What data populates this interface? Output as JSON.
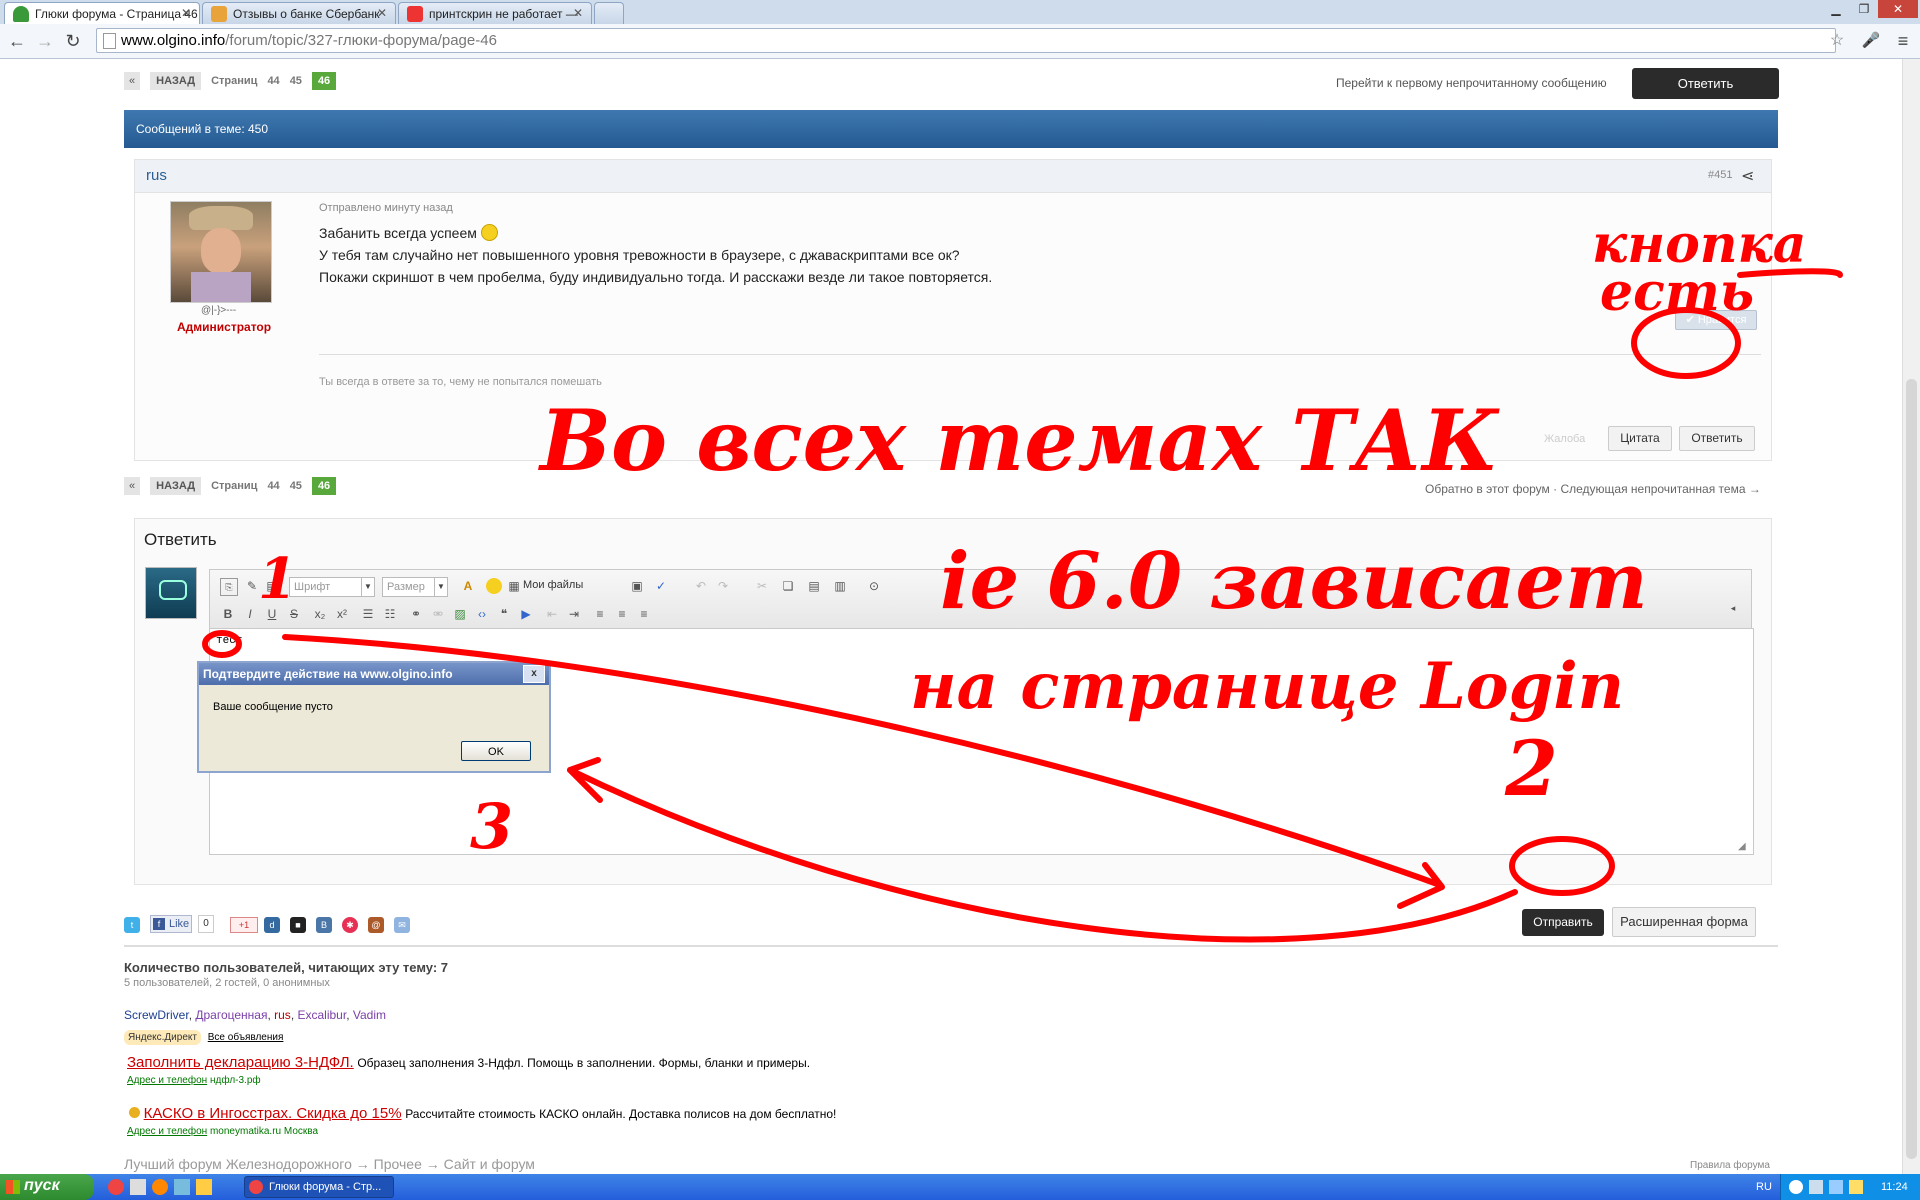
{
  "browser": {
    "tabs": [
      {
        "title": "Глюки форума - Страница 46",
        "active": true
      },
      {
        "title": "Отзывы о банке Сбербанк",
        "active": false
      },
      {
        "title": "принтскрин не работает — ",
        "active": false
      }
    ],
    "url_host": "www.olgino.info",
    "url_path": "/forum/topic/327-глюки-форума/page-46"
  },
  "pager": {
    "prev": "«",
    "back": "НАЗАД",
    "pages_label": "Страниц",
    "pages": [
      "44",
      "45"
    ],
    "current": "46"
  },
  "top": {
    "unread_link": "Перейти к первому непрочитанному сообщению",
    "reply_button": "Ответить"
  },
  "thread": {
    "count_label": "Сообщений в теме: 450"
  },
  "post": {
    "author": "rus",
    "number": "#451",
    "time": "Отправлено минуту назад",
    "lines": [
      "Забанить всегда успеем",
      "У тебя там случайно нет повышенного уровня тревожности в браузере, с джаваскриптами все ок?",
      "Покажи скриншот в чем пробелма, буду индивидуально тогда. И расскажи везде ли такое повторяется."
    ],
    "user_title": "@|-}>---",
    "role": "Администратор",
    "signature": "Ты всегда в ответе за то, чему не попытался помешать",
    "like_button": "Нравится",
    "report": "Жалоба",
    "quote_button": "Цитата",
    "reply_button": "Ответить"
  },
  "bottom_nav": {
    "back_to_forum": "Обратно в этот форум",
    "next_unread": "Следующая непрочитанная тема →"
  },
  "reply": {
    "heading": "Ответить",
    "font_combo": "Шрифт",
    "size_combo": "Размер",
    "my_files": "Мои файлы",
    "editor_text": "тест",
    "send_button": "Отправить",
    "advanced_button": "Расширенная форма"
  },
  "dialog": {
    "title": "Подтвердите действие на www.olgino.info",
    "close": "x",
    "message": "Ваше сообщение пусто",
    "ok": "OK"
  },
  "share": {
    "like_label": "Like",
    "like_count": "0",
    "gplus": "+1"
  },
  "readers": {
    "title": "Количество пользователей, читающих эту тему: 7",
    "summary": "5 пользователей, 2 гостей, 0 анонимных",
    "users": [
      {
        "name": "ScrewDriver",
        "color": "#1d3f8f"
      },
      {
        "name": "Драгоценная",
        "color": "#7a3fa8"
      },
      {
        "name": "rus",
        "color": "#c00000"
      },
      {
        "name": "Excalibur",
        "color": "#7a3fa8"
      },
      {
        "name": "Vadim",
        "color": "#7a3fa8"
      }
    ]
  },
  "ads": {
    "badge": "Яндекс.Директ",
    "all_ads": "Все объявления",
    "items": [
      {
        "title": "Заполнить декларацию 3-НДФЛ.",
        "text": "Образец заполнения 3-Ндфл. Помощь в заполнении. Формы, бланки и примеры.",
        "contact": "Адрес и телефон",
        "domain": "ндфл-3.рф"
      },
      {
        "title": "КАСКО в Ингосстрах. Скидка до 15%",
        "text": "Рассчитайте стоимость КАСКО онлайн. Доставка полисов на дом бесплатно!",
        "contact": "Адрес и телефон",
        "domain": "moneymatika.ru Москва"
      }
    ]
  },
  "footer": {
    "breadcrumb": "Лучший форум Железнодорожного → Прочее → Сайт и форум",
    "rules": "Правила форума"
  },
  "annotations": {
    "button_exists": [
      "кнопка",
      "есть"
    ],
    "all_topics": "Во всех темах ТАК",
    "ie_hangs": "ie 6.0 зависает",
    "login_page": "на странице Login",
    "marks": [
      "1",
      "2",
      "3"
    ]
  },
  "taskbar": {
    "start": "пуск",
    "task": "Глюки форума - Стр...",
    "lang": "RU",
    "clock": "11:24"
  },
  "colors": {
    "accent_blue": "#2b5f96",
    "green": "#59a83b",
    "annotation_red": "#ff0000"
  }
}
